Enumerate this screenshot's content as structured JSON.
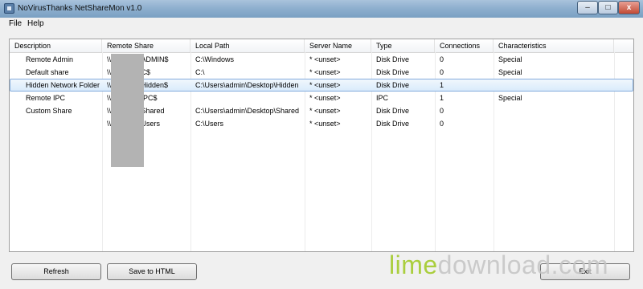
{
  "window": {
    "title": "NoVirusThanks NetShareMon v1.0"
  },
  "controls": {
    "minimize": "–",
    "maximize": "□",
    "close": "x"
  },
  "menu": {
    "file": "File",
    "help": "Help"
  },
  "table": {
    "columns": [
      "Description",
      "Remote Share",
      "Local Path",
      "Server Name",
      "Type",
      "Connections",
      "Characteristics"
    ],
    "rows": [
      [
        "Remote Admin",
        "\\\\",
        "\\ADMIN$",
        "C:\\Windows",
        "* <unset>",
        "Disk Drive",
        "0",
        "Special"
      ],
      [
        "Default share",
        "\\\\",
        "\\C$",
        "C:\\",
        "* <unset>",
        "Disk Drive",
        "0",
        "Special"
      ],
      [
        "Hidden Network Folder",
        "\\\\",
        "\\Hidden$",
        "C:\\Users\\admin\\Desktop\\Hidden",
        "* <unset>",
        "Disk Drive",
        "1",
        ""
      ],
      [
        "Remote IPC",
        "\\\\",
        "\\IPC$",
        "",
        "* <unset>",
        "IPC",
        "1",
        "Special"
      ],
      [
        "Custom Share",
        "\\\\",
        "\\Shared",
        "C:\\Users\\admin\\Desktop\\Shared",
        "* <unset>",
        "Disk Drive",
        "0",
        ""
      ],
      [
        "",
        "\\\\",
        "\\Users",
        "C:\\Users",
        "* <unset>",
        "Disk Drive",
        "0",
        ""
      ]
    ],
    "selected_row": 2
  },
  "buttons": {
    "refresh": "Refresh",
    "save_html": "Save to HTML",
    "exit": "Exit"
  },
  "watermark": {
    "part1": "lime",
    "part2": "download.com"
  },
  "colors": {
    "selection_border": "#84acdd",
    "selection_fill": "#d9ebfb",
    "titlebar": "#8fb0cf"
  }
}
